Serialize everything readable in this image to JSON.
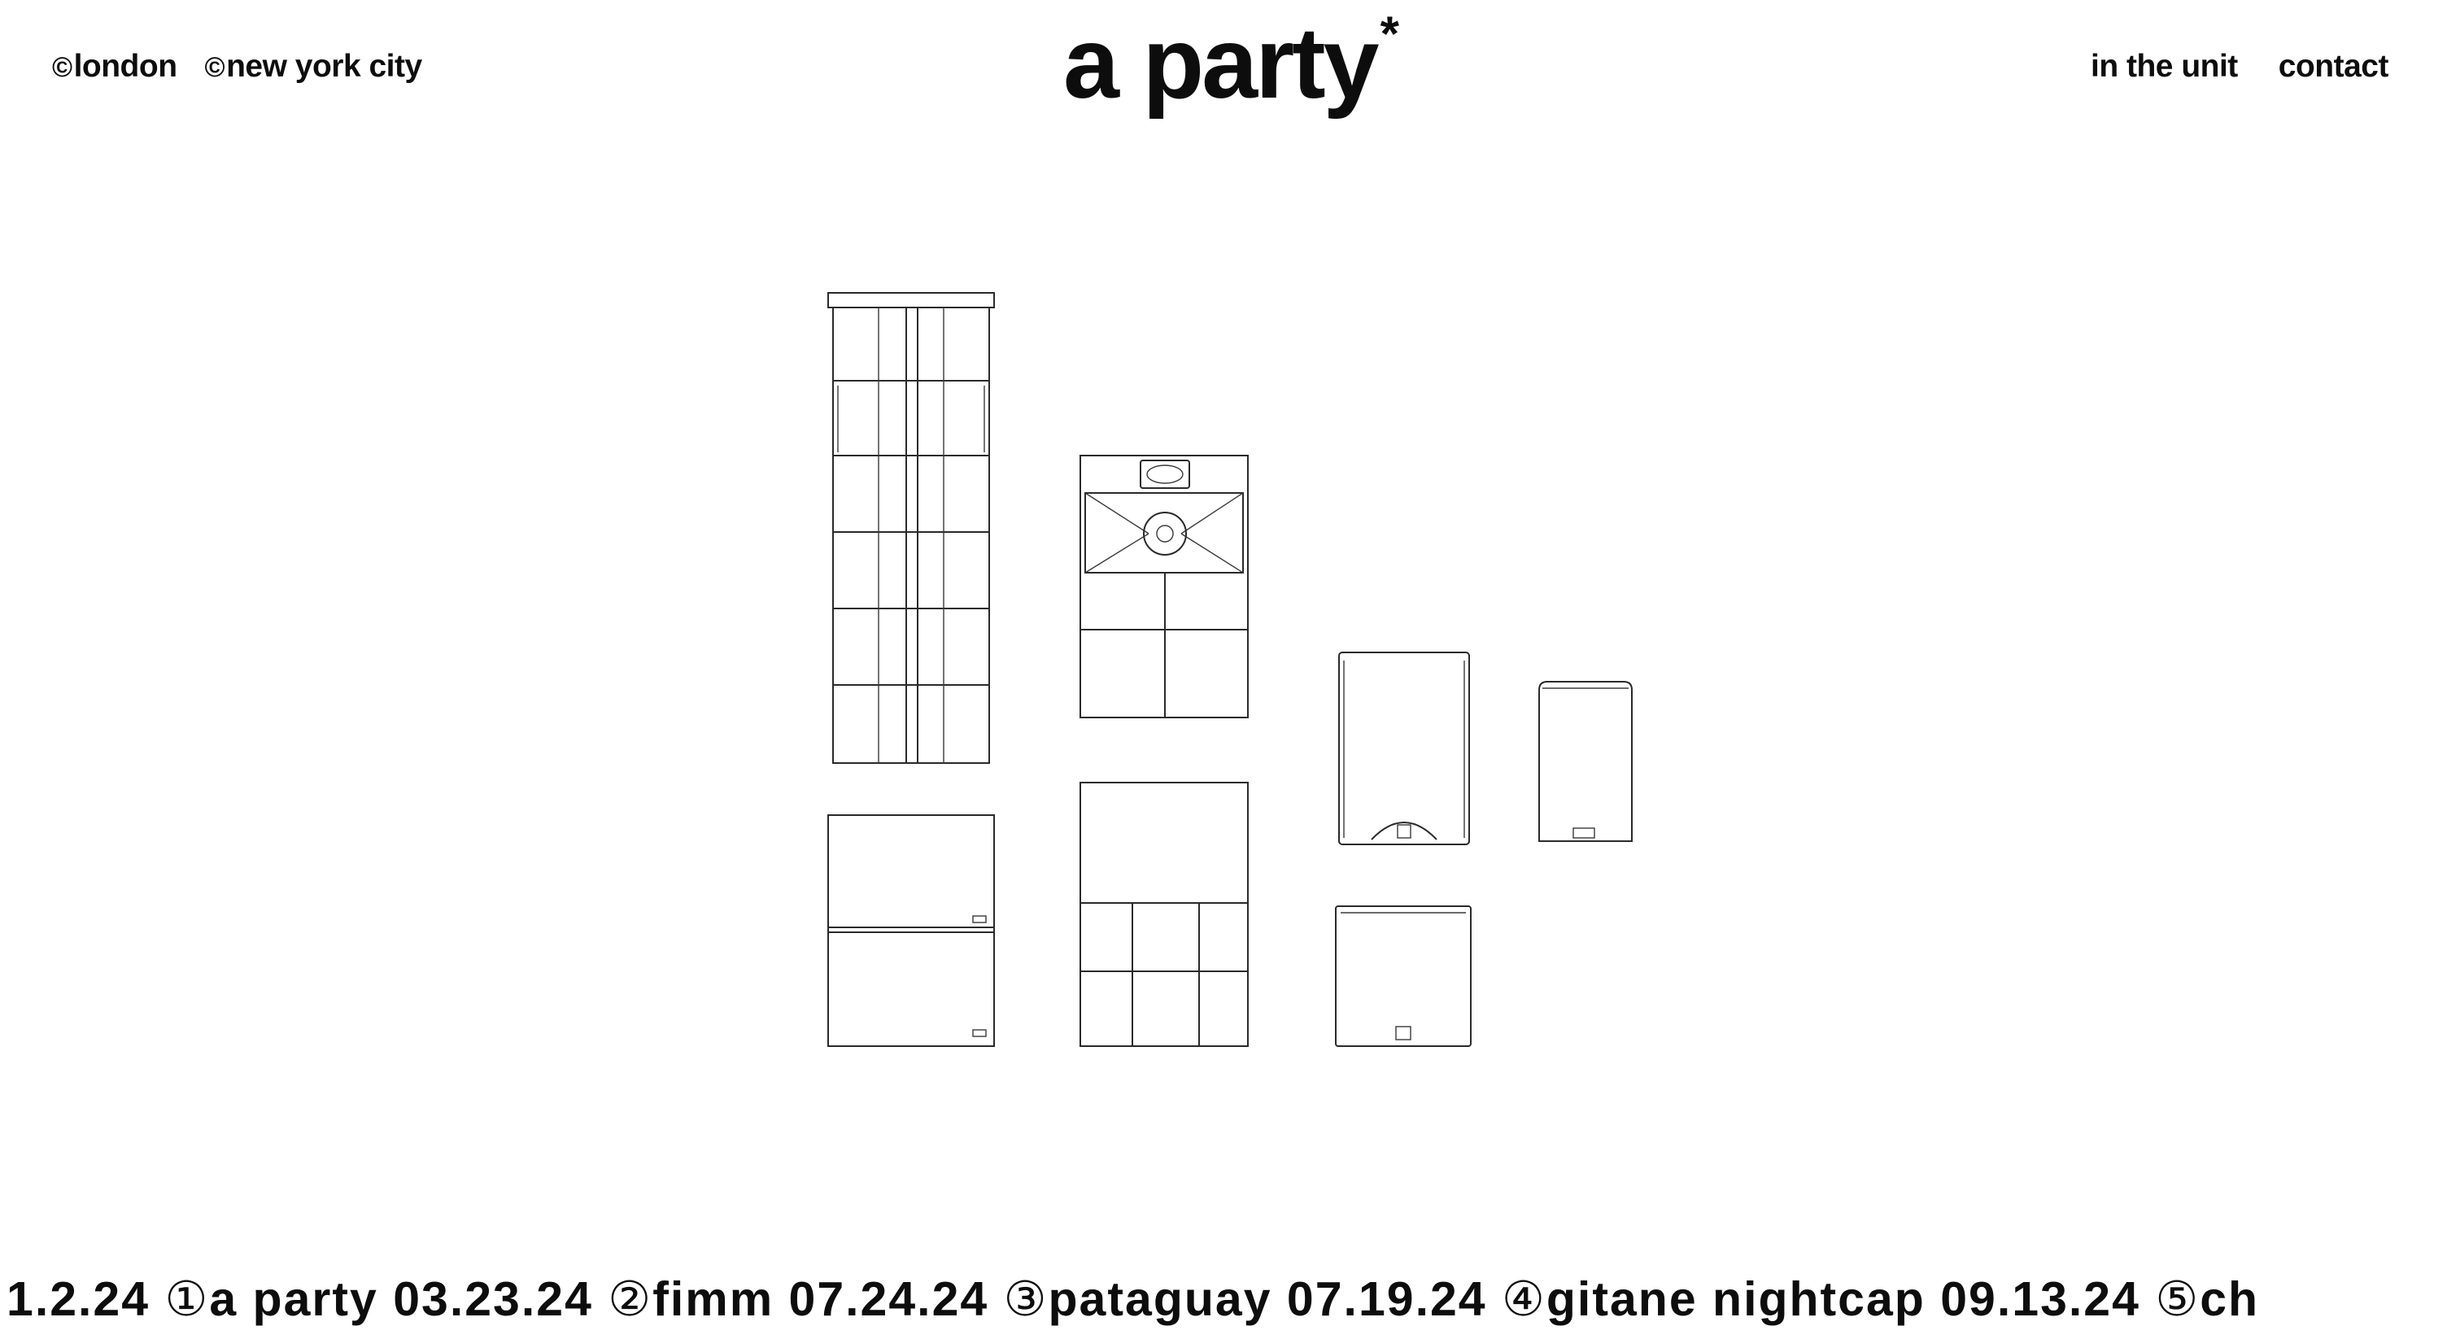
{
  "header": {
    "locations": [
      {
        "mark": "©",
        "label": "london"
      },
      {
        "mark": "©",
        "label": "new york city"
      }
    ],
    "logo": {
      "text": "a party",
      "mark": "*"
    },
    "nav": [
      {
        "label": "in the unit"
      },
      {
        "label": "contact"
      }
    ]
  },
  "ticker": {
    "items": [
      {
        "lead": "1.2.24 ",
        "num": "",
        "name": ""
      },
      {
        "lead": "",
        "num": "①",
        "name": "a party 03.23.24 "
      },
      {
        "lead": "",
        "num": "②",
        "name": "fimm 07.24.24 "
      },
      {
        "lead": "",
        "num": "③",
        "name": "pataguay 07.19.24 "
      },
      {
        "lead": "",
        "num": "④",
        "name": "gitane nightcap 09.13.24 "
      },
      {
        "lead": "",
        "num": "⑤",
        "name": "ch"
      }
    ]
  },
  "illustration": {
    "speakers": [
      {
        "name": "line-array-column"
      },
      {
        "name": "horn-cabinet"
      },
      {
        "name": "tall-top-cabinet"
      },
      {
        "name": "small-monitor-cabinet"
      },
      {
        "name": "double-sub-stack"
      },
      {
        "name": "grid-sub-cabinet"
      },
      {
        "name": "square-sub-cabinet"
      }
    ]
  }
}
